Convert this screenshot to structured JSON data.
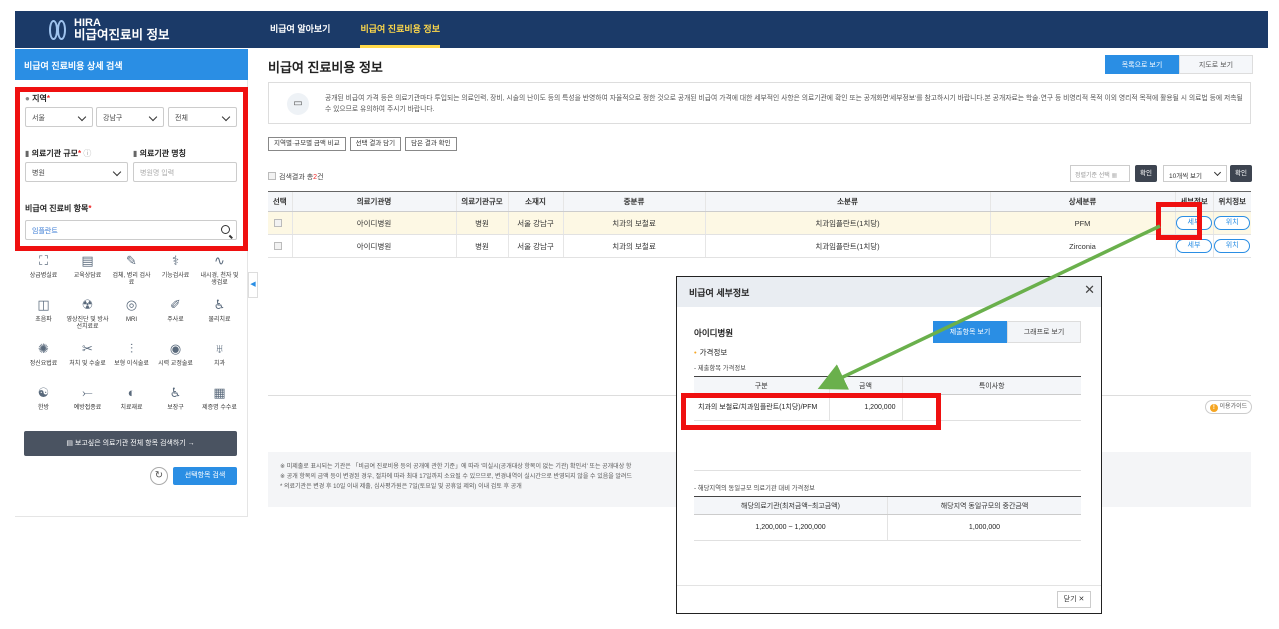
{
  "header": {
    "logo_line1": "HIRA",
    "logo_line2": "비급여진료비 정보",
    "nav": [
      "비급여 알아보기",
      "비급여 진료비용 정보"
    ]
  },
  "sidebar": {
    "title": "비급여 진료비용 상세 검색",
    "region_label": "지역",
    "region_values": [
      "서울",
      "강남구",
      "전체"
    ],
    "size_label": "의료기관 규모",
    "size_value": "병원",
    "name_label": "의료기관 명칭",
    "name_placeholder": "병원명 입력",
    "item_label": "비급여 진료비 항목",
    "item_value": "임플란트",
    "categories": [
      {
        "label": "상급병실료",
        "icon": "bed-icon"
      },
      {
        "label": "교육상담료",
        "icon": "consult-icon"
      },
      {
        "label": "검체, 병리 검사료",
        "icon": "lab-icon"
      },
      {
        "label": "기능검사료",
        "icon": "function-test-icon"
      },
      {
        "label": "내시경, 천자 및 생검료",
        "icon": "endoscope-icon"
      },
      {
        "label": "초음파",
        "icon": "ultrasound-icon"
      },
      {
        "label": "영상진단 및 방사선치료료",
        "icon": "radiology-icon"
      },
      {
        "label": "MRI",
        "icon": "mri-icon"
      },
      {
        "label": "주사료",
        "icon": "injection-icon"
      },
      {
        "label": "물리치료",
        "icon": "physio-icon"
      },
      {
        "label": "정신요법료",
        "icon": "psychotherapy-icon"
      },
      {
        "label": "처치 및 수술료",
        "icon": "surgery-icon"
      },
      {
        "label": "보형 이식술료",
        "icon": "implant-graft-icon"
      },
      {
        "label": "시력 교정술료",
        "icon": "eye-icon"
      },
      {
        "label": "치과",
        "icon": "tooth-icon"
      },
      {
        "label": "한방",
        "icon": "oriental-medicine-icon"
      },
      {
        "label": "예방접종료",
        "icon": "vaccine-icon"
      },
      {
        "label": "치료재료",
        "icon": "material-icon"
      },
      {
        "label": "보장구",
        "icon": "wheelchair-icon"
      },
      {
        "label": "제증명 수수료",
        "icon": "certificate-icon"
      }
    ],
    "all_search_label": "보고싶은 의료기관 전체 항목 검색하기",
    "search_button": "선택항목 검색"
  },
  "main": {
    "title": "비급여 진료비용 정보",
    "view_tabs": [
      "목록으로 보기",
      "지도로 보기"
    ],
    "info": "공개된 비급여 가격 등은 의료기관마다 투입되는 의료인력, 장비, 시술의 난이도 등의 특성을 반영하여 자율적으로 정한 것으로 공개된 비급여 가격에 대한 세부적인 사항은 의료기관에 확인 또는 공개화면'세부정보'를 참고하시기 바랍니다.본 공개자료는 학술·연구 등 비영리적 목적 이외 영리적 목적에 활용될 시 의료법 등에 저촉될 수 있으므로 유의하여 주시기 바랍니다.",
    "small_buttons": [
      "지역별·규모별 금액 비교",
      "선택 결과 담기",
      "담은 결과 확인"
    ],
    "count_prefix": "검색결과 총",
    "count_value": "2",
    "count_suffix": "건",
    "sort_placeholder": "정렬기준 선택",
    "confirm": "확인",
    "per_page": "10개씩 보기",
    "columns": [
      "선택",
      "의료기관명",
      "의료기관규모",
      "소재지",
      "중분류",
      "소분류",
      "상세분류",
      "세부정보",
      "위치정보"
    ],
    "rows": [
      {
        "name": "아이디병원",
        "size": "병원",
        "loc": "서울 강남구",
        "mid": "치과의 보철료",
        "small": "치과임플란트(1치당)",
        "detail": "PFM",
        "btn_detail": "세부",
        "btn_loc": "위치"
      },
      {
        "name": "아이디병원",
        "size": "병원",
        "loc": "서울 강남구",
        "mid": "치과의 보철료",
        "small": "치과임플란트(1치당)",
        "detail": "Zirconia",
        "btn_detail": "세부",
        "btn_loc": "위치"
      }
    ],
    "guide": "이용가이드",
    "notes": [
      "※ 미제출로 표시되는 기관은 「비급여 진료비용 등의 공개에 관한 기준」에 따라 '미실시(공개대상 항목이 없는 기관) 확인서' 또는 공개대상 항",
      "※ 공개 항목의 금액 등이 변경된 경우, 절차에 따라 최대 17일까지 소요될 수 있으므로, 변경내역이 실시간으로 반영되지 않을 수 있음을 알려드",
      "* 의료기관은 변경 후 10일 이내 제출, 심사평가원은 7일(토요일 및 공휴일 제외) 이내 검토 후 공개"
    ]
  },
  "modal": {
    "title": "비급여 세부정보",
    "hospital": "아이디병원",
    "tabs": [
      "제출항목 보기",
      "그래프로 보기"
    ],
    "section": "가격정보",
    "sub1": "- 제출항목 가격정보",
    "cols": [
      "구분",
      "금액",
      "특이사항"
    ],
    "item": "치과의 보철료/치과임플란트(1치당)/PFM",
    "price": "1,200,000",
    "remark": "",
    "sub2": "- 해당지역의 동일규모 의료기관 대비 가격정보",
    "cols2": [
      "해당의료기관(최저금액~최고금액)",
      "해당지역 동일규모의 중간금액"
    ],
    "range": "1,200,000 ~ 1,200,000",
    "median": "1,000,000",
    "close": "닫기"
  },
  "colors": {
    "header": "#1b3a68",
    "accent": "#2a8ee4",
    "highlight": "#ef1010",
    "arrow": "#6ab04c"
  }
}
